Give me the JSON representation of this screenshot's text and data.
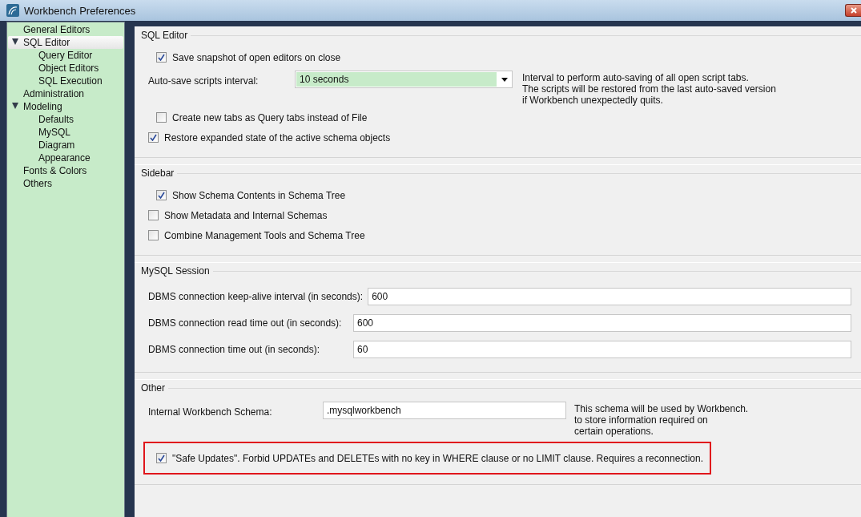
{
  "window": {
    "title": "Workbench Preferences"
  },
  "sidebar": {
    "items": [
      {
        "label": "General Editors",
        "selected": false
      },
      {
        "label": "SQL Editor",
        "selected": true,
        "expanded": true,
        "children": [
          {
            "label": "Query Editor",
            "selected": false
          },
          {
            "label": "Object Editors",
            "selected": false
          },
          {
            "label": "SQL Execution",
            "selected": false
          }
        ]
      },
      {
        "label": "Administration",
        "selected": false
      },
      {
        "label": "Modeling",
        "selected": false,
        "expanded": true,
        "children": [
          {
            "label": "Defaults",
            "selected": false
          },
          {
            "label": "MySQL",
            "selected": false
          },
          {
            "label": "Diagram",
            "selected": false
          },
          {
            "label": "Appearance",
            "selected": false
          }
        ]
      },
      {
        "label": "Fonts & Colors",
        "selected": false
      },
      {
        "label": "Others",
        "selected": false
      }
    ]
  },
  "sections": [
    {
      "title": "SQL Editor",
      "rows": [
        {
          "kind": "checkbox",
          "label": "Save snapshot of open editors on close",
          "checked": true,
          "nested": true
        },
        {
          "kind": "dropdown",
          "label": "Auto-save scripts interval:",
          "value": "10 seconds",
          "note": [
            "Interval to perform auto-saving of all open script tabs.",
            "The scripts will be restored from the last auto-saved version",
            "if Workbench unexpectedly quits."
          ]
        },
        {
          "kind": "checkbox",
          "label": "Create new tabs as Query tabs instead of File",
          "checked": false,
          "nested": true
        },
        {
          "kind": "checkbox",
          "label": "Restore expanded state of the active schema objects",
          "checked": true,
          "nested": false
        }
      ]
    },
    {
      "title": "Sidebar",
      "rows": [
        {
          "kind": "checkbox",
          "label": "Show Schema Contents in Schema Tree",
          "checked": true,
          "nested": true
        },
        {
          "kind": "checkbox",
          "label": "Show Metadata and Internal Schemas",
          "checked": false,
          "nested": false
        },
        {
          "kind": "checkbox",
          "label": "Combine Management Tools and Schema Tree",
          "checked": false,
          "nested": false
        }
      ]
    },
    {
      "title": "MySQL Session",
      "rows": [
        {
          "kind": "number",
          "label": "DBMS connection keep-alive interval (in seconds):",
          "value": "600"
        },
        {
          "kind": "number",
          "label": "DBMS connection read time out (in seconds):",
          "value": "600"
        },
        {
          "kind": "number",
          "label": "DBMS connection time out (in seconds):",
          "value": "60"
        }
      ]
    },
    {
      "title": "Other",
      "rows": [
        {
          "kind": "text",
          "label": "Internal Workbench Schema:",
          "value": ".mysqlworkbench",
          "note": [
            "This schema will be used by Workbench.",
            "to store information required on",
            "certain operations."
          ]
        },
        {
          "kind": "checkbox",
          "label": "\"Safe Updates\". Forbid UPDATEs and DELETEs with no key in WHERE clause or no LIMIT clause. Requires a reconnection.",
          "checked": true,
          "highlighted": true
        }
      ]
    }
  ]
}
